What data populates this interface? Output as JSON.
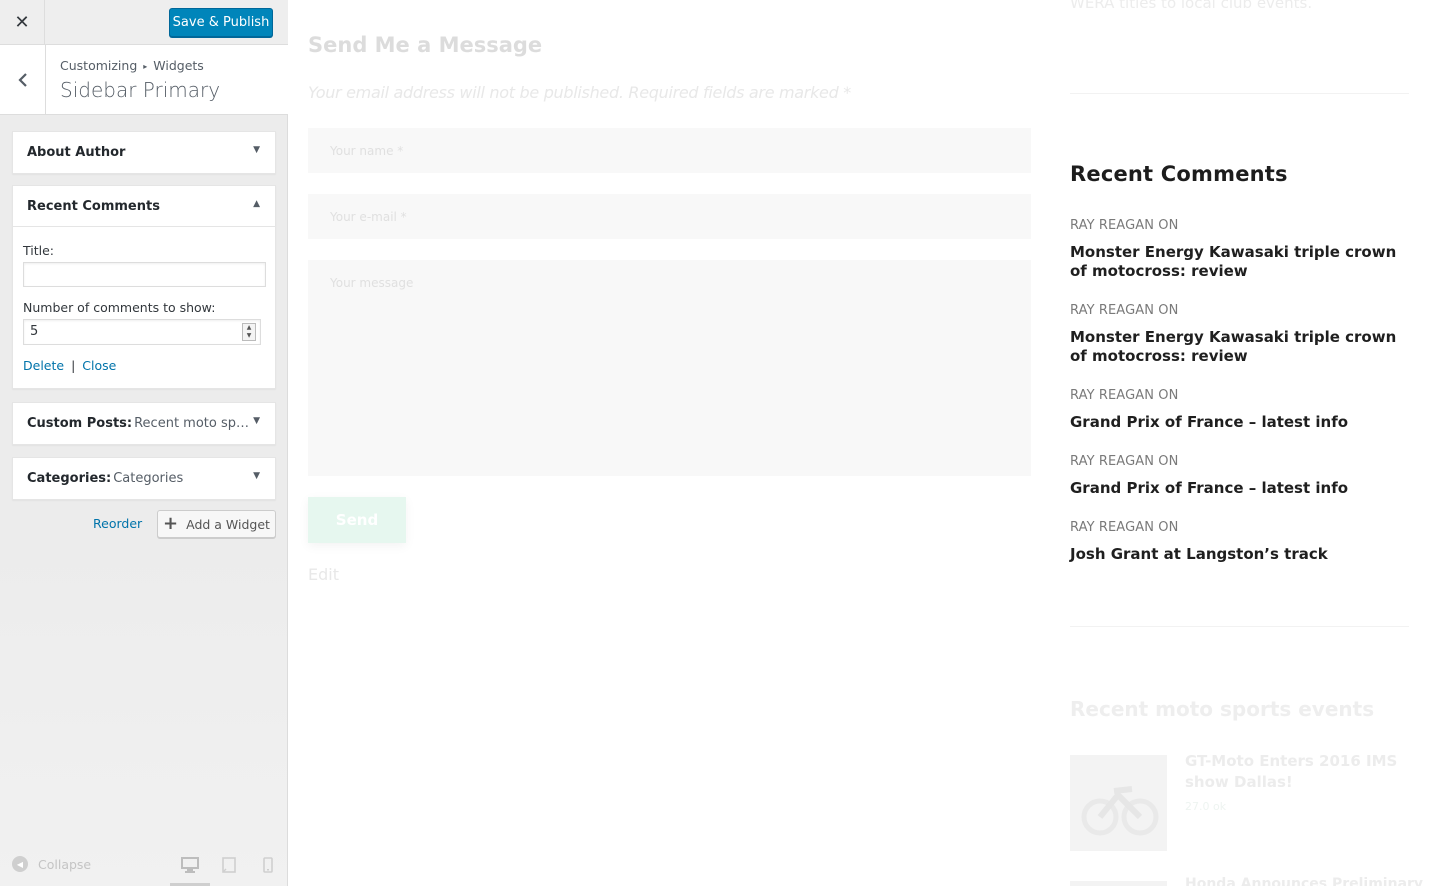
{
  "topbar": {
    "close_glyph": "✕",
    "publish_label": "Save & Publish"
  },
  "panel": {
    "back_glyph": "‹",
    "breadcrumb_root": "Customizing",
    "breadcrumb_sep": "▸",
    "breadcrumb_section": "Widgets",
    "title": "Sidebar Primary"
  },
  "widgets": {
    "about": {
      "title": "About Author",
      "arrow": "▼"
    },
    "recent": {
      "title": "Recent Comments",
      "arrow": "▲",
      "title_label": "Title:",
      "title_value": "",
      "number_label": "Number of comments to show:",
      "number_value": "5",
      "delete_label": "Delete",
      "separator": "|",
      "close_label": "Close"
    },
    "custom_posts": {
      "title": "Custom Posts:",
      "subtitle": "Recent moto sports events",
      "arrow": "▼"
    },
    "categories": {
      "title": "Categories:",
      "subtitle": "Categories",
      "arrow": "▼"
    }
  },
  "actions": {
    "reorder_label": "Reorder",
    "add_widget_label": "Add a Widget",
    "add_icon": "+"
  },
  "footer": {
    "collapse_label": "Collapse",
    "collapse_icon": "◀",
    "devices": [
      "desktop-icon",
      "tablet-icon",
      "mobile-icon"
    ]
  },
  "preview": {
    "top_snippet": "WERA titles to local club events.",
    "contact": {
      "title": "Send Me a Message",
      "note": "Your email address will not be published. Required fields are marked *",
      "name_placeholder": "Your name *",
      "email_placeholder": "Your e-mail *",
      "message_placeholder": "Your message",
      "send_label": "Send",
      "edit_label": "Edit"
    },
    "recent_comments": {
      "title": "Recent Comments",
      "items": [
        {
          "author": "RAY REAGAN ON",
          "post": "Monster Energy Kawasaki triple crown of motocross: review"
        },
        {
          "author": "RAY REAGAN ON",
          "post": "Monster Energy Kawasaki triple crown of motocross: review"
        },
        {
          "author": "RAY REAGAN ON",
          "post": "Grand Prix of France – latest info"
        },
        {
          "author": "RAY REAGAN ON",
          "post": "Grand Prix of France – latest info"
        },
        {
          "author": "RAY REAGAN ON",
          "post": "Josh Grant at Langston’s track"
        }
      ]
    },
    "events": {
      "title": "Recent moto sports events",
      "item_title": "GT-Moto Enters 2016 IMS show Dallas!",
      "item_meta": "27.0 ok",
      "item2_title": "Honda Announces Preliminary"
    }
  },
  "colors": {
    "primary": "#0085ba",
    "link": "#0073aa",
    "sidebar_bg": "#ececec"
  }
}
